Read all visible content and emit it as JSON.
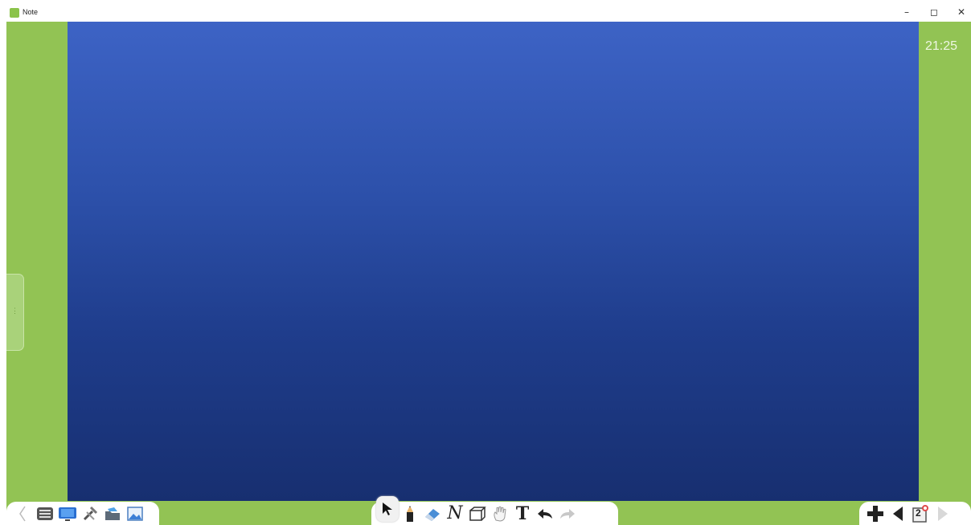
{
  "window": {
    "title": "Note",
    "controls": {
      "minimize": "–",
      "maximize": "◻",
      "close": "✕"
    }
  },
  "colors": {
    "background": "#92c354",
    "board_top": "#3d63c5",
    "board_bottom": "#172f70",
    "toolbar": "#ffffff"
  },
  "clock": {
    "time": "21:25"
  },
  "toolbar_left": {
    "items": [
      "prev-arrow-icon",
      "menu-icon",
      "screen-icon",
      "tools-icon",
      "open-folder-icon",
      "image-gallery-icon"
    ]
  },
  "toolbar_center": {
    "items": [
      "select-icon",
      "pen-icon",
      "eraser-icon",
      "curve-icon",
      "shape-3d-icon",
      "hand-icon",
      "text-icon",
      "undo-icon",
      "redo-icon"
    ],
    "curve_glyph": "N",
    "text_glyph": "T"
  },
  "toolbar_right": {
    "items": [
      "add-page-icon",
      "previous-page-icon",
      "page-list-icon",
      "next-page-icon"
    ],
    "page_count": "2"
  }
}
